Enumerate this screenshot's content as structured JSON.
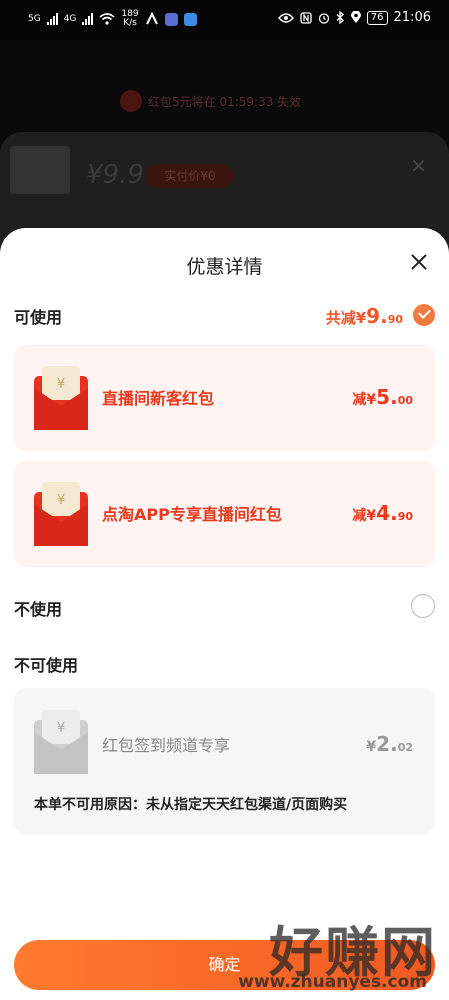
{
  "status_bar": {
    "network": "5G",
    "network2": "4G",
    "speed_value": "189",
    "speed_unit": "K/s",
    "battery": "76",
    "time": "21:06"
  },
  "background": {
    "countdown_text": "红包5元将在 01:59:33 失效",
    "price": "9.9",
    "price_pill": "实付价¥0"
  },
  "sheet": {
    "title": "优惠详情",
    "usable_label": "可使用",
    "total_prefix": "共减¥",
    "total_int": "9.",
    "total_dec": "90",
    "coupons": [
      {
        "name": "直播间新客红包",
        "prefix": "减¥",
        "int": "5.",
        "dec": "00"
      },
      {
        "name": "点淘APP专享直播间红包",
        "prefix": "减¥",
        "int": "4.",
        "dec": "90"
      }
    ],
    "not_use_label": "不使用",
    "unusable_label": "不可使用",
    "unusable_coupon": {
      "name": "红包签到频道专享",
      "prefix": "¥",
      "int": "2.",
      "dec": "02",
      "reason": "本单不可用原因：未从指定天天红包渠道/页面购买"
    },
    "confirm_label": "确定"
  },
  "watermark": {
    "big": "好赚网",
    "small": "www.zhuanyes.com"
  },
  "colors": {
    "accent": "#f2552c",
    "coupon_bg": "#fff4f1",
    "envelope_red": "#e8321f"
  }
}
